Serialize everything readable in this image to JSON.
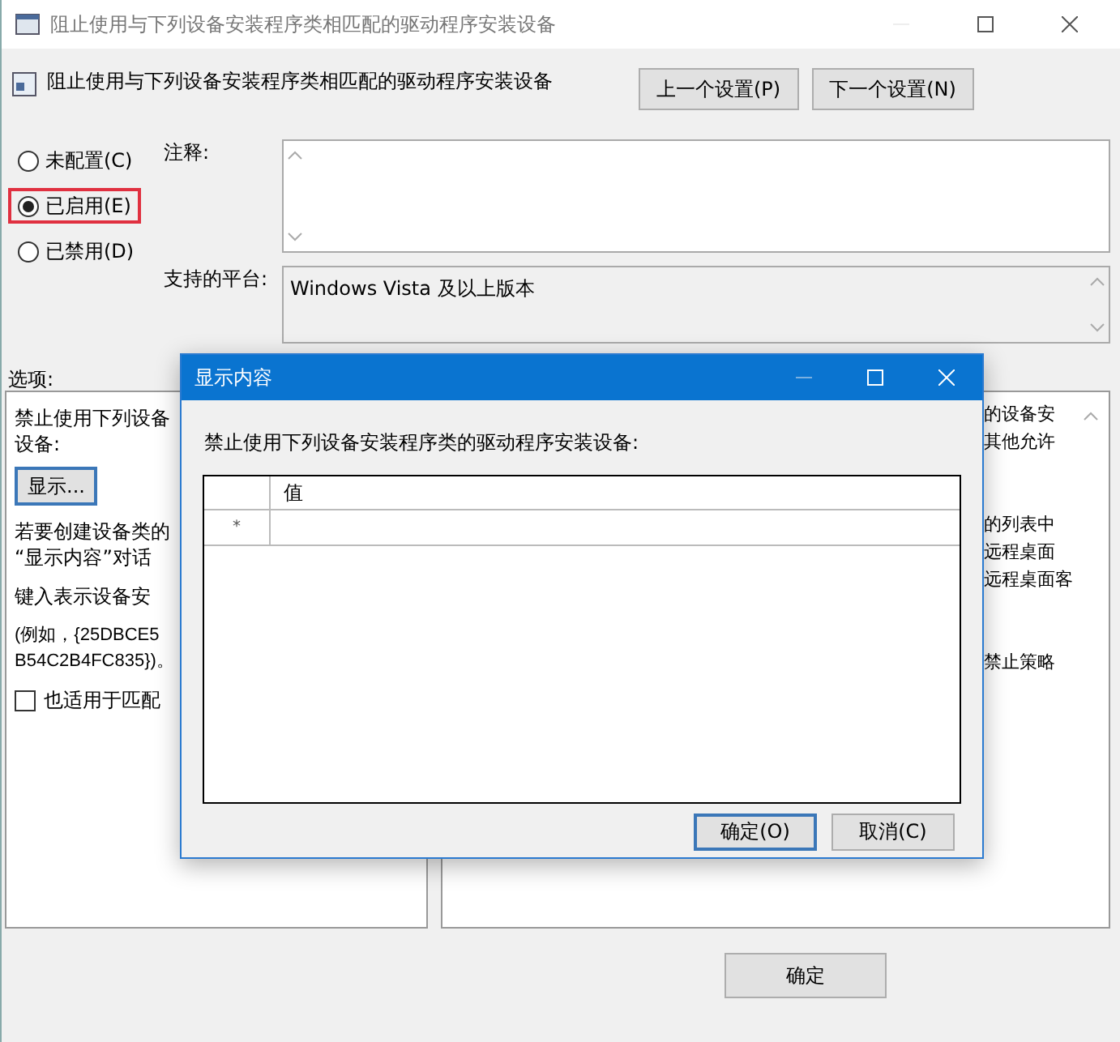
{
  "window": {
    "title": "阻止使用与下列设备安装程序类相匹配的驱动程序安装设备"
  },
  "header": {
    "title": "阻止使用与下列设备安装程序类相匹配的驱动程序安装设备",
    "buttons": [
      "上一个设置(P)",
      "下一个设置(N)"
    ]
  },
  "state_options": [
    {
      "label": "未配置(C)",
      "selected": false,
      "highlighted": false
    },
    {
      "label": "已启用(E)",
      "selected": true,
      "highlighted": true
    },
    {
      "label": "已禁用(D)",
      "selected": false,
      "highlighted": false
    }
  ],
  "comment": {
    "label": "注释:"
  },
  "platform": {
    "label": "支持的平台:",
    "value": "Windows Vista 及以上版本"
  },
  "options_label": "选项:",
  "options_panel": {
    "lines": [
      "禁止使用下列设备",
      "设备:"
    ],
    "button": "显示...",
    "texts": [
      "若要创建设备类的",
      "“显示内容”对话",
      "键入表示设备安",
      "(例如，{25DBCE5",
      "B54C2B4FC835})。"
    ],
    "checkbox": {
      "label": "也适用于匹配",
      "checked": false
    }
  },
  "help_panel": {
    "paragraphs": [
      [
        "的设备安",
        "其他允许"
      ],
      [
        "的列表中",
        "远程桌面",
        "远程桌面客"
      ],
      [
        "禁止策略"
      ]
    ]
  },
  "footer": {
    "buttons": [
      "确定"
    ]
  },
  "dialog": {
    "title": "显示内容",
    "label": "禁止使用下列设备安装程序类的驱动程序安装设备:",
    "grid": {
      "column": "值",
      "rows": [
        {
          "marker": "*"
        }
      ]
    },
    "buttons": [
      "确定(O)",
      "取消(C)"
    ]
  }
}
